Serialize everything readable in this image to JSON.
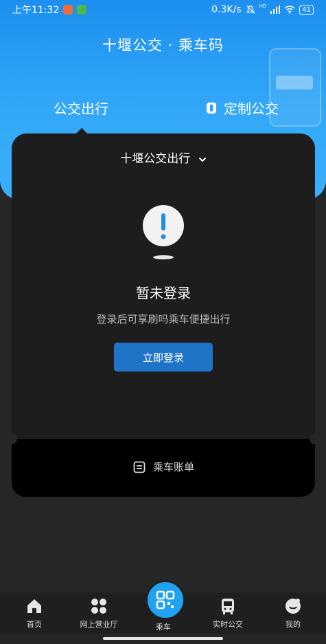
{
  "status_bar": {
    "time": "上午11:32",
    "net_speed": "0.3K/s",
    "battery": "41",
    "network_tag": "HD"
  },
  "header": {
    "title": "十堰公交 · 乘车码",
    "tabs": [
      "公交出行",
      "定制公交"
    ]
  },
  "card": {
    "line_selector": "十堰公交出行",
    "empty_title": "暂未登录",
    "empty_subtitle": "登录后可享刷吗乘车便捷出行",
    "login_button": "立即登录",
    "bill_label": "乘车账单"
  },
  "bottom_nav": {
    "items": [
      "首页",
      "网上营业厅",
      "乘车",
      "实时公交",
      "我的"
    ]
  },
  "colors": {
    "accent": "#1f74c8",
    "header_blue": "#2aa0f5",
    "nav_center": "#1fa3f0"
  }
}
